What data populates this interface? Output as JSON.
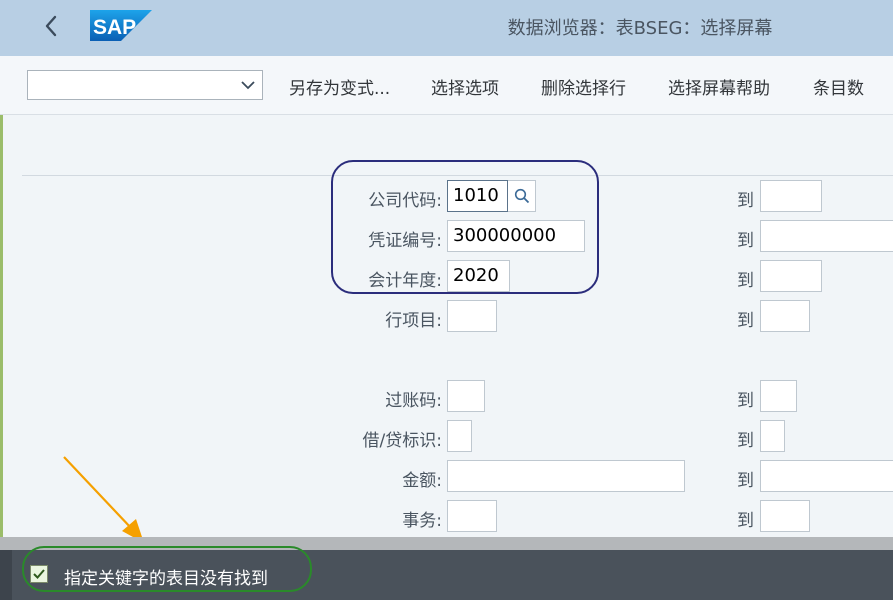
{
  "header": {
    "title": "数据浏览器：表BSEG：选择屏幕",
    "logo_text": "SAP"
  },
  "toolbar": {
    "variant_value": "",
    "save_as_variant": "另存为变式...",
    "selection_options": "选择选项",
    "delete_selection_row": "删除选择行",
    "selection_screen_help": "选择屏幕帮助",
    "entry_count": "条目数"
  },
  "form": {
    "to_label": "到",
    "company_code": {
      "label": "公司代码:",
      "value": "1010",
      "to_value": ""
    },
    "document_number": {
      "label": "凭证编号:",
      "value": "300000000",
      "to_value": ""
    },
    "fiscal_year": {
      "label": "会计年度:",
      "value": "2020",
      "to_value": ""
    },
    "line_item": {
      "label": "行项目:",
      "value": "",
      "to_value": ""
    },
    "posting_key": {
      "label": "过账码:",
      "value": "",
      "to_value": ""
    },
    "debit_credit": {
      "label": "借/贷标识:",
      "value": "",
      "to_value": ""
    },
    "amount": {
      "label": "金额:",
      "value": "",
      "to_value": ""
    },
    "transaction": {
      "label": "事务:",
      "value": "",
      "to_value": ""
    }
  },
  "status": {
    "message": "指定关键字的表目没有找到"
  },
  "colors": {
    "shell": "#b8cfe4",
    "footer": "#4a525b",
    "highlight_blue": "#2b2d7c",
    "highlight_green": "#2a8a2a",
    "arrow": "#f5a000"
  }
}
